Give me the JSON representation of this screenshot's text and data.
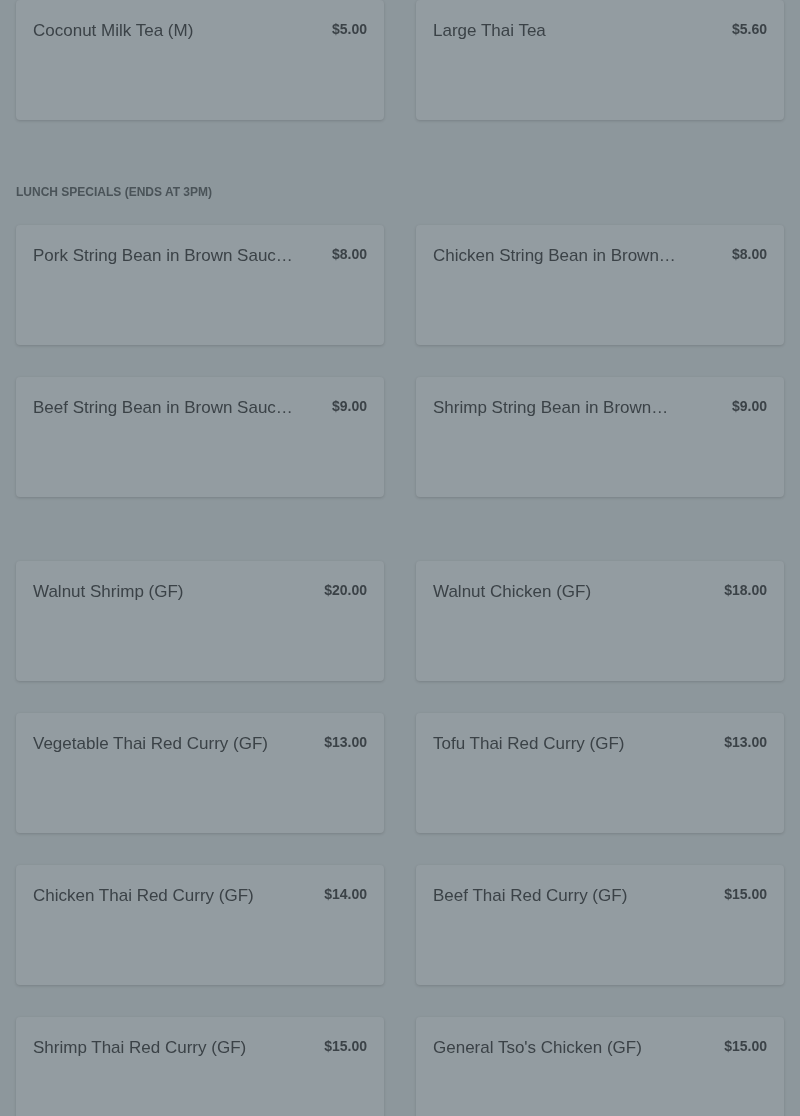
{
  "sections": [
    {
      "items": [
        {
          "name": "Coconut Milk Tea (M)",
          "price": "$5.00"
        },
        {
          "name": "Large Thai Tea",
          "price": "$5.60"
        }
      ]
    },
    {
      "title": "LUNCH SPECIALS (ENDS AT 3PM)",
      "items": [
        {
          "name": "Pork String Bean in Brown Sauc…",
          "price": "$8.00"
        },
        {
          "name": "Chicken String Bean in Brown…",
          "price": "$8.00"
        },
        {
          "name": "Beef String Bean in Brown Sauc…",
          "price": "$9.00"
        },
        {
          "name": "Shrimp String Bean in Brown…",
          "price": "$9.00"
        }
      ]
    },
    {
      "items": [
        {
          "name": "Walnut Shrimp (GF)",
          "price": "$20.00"
        },
        {
          "name": "Walnut Chicken (GF)",
          "price": "$18.00"
        },
        {
          "name": "Vegetable Thai Red Curry (GF)",
          "price": "$13.00"
        },
        {
          "name": "Tofu Thai Red Curry (GF)",
          "price": "$13.00"
        },
        {
          "name": "Chicken Thai Red Curry (GF)",
          "price": "$14.00"
        },
        {
          "name": "Beef Thai Red Curry (GF)",
          "price": "$15.00"
        },
        {
          "name": "Shrimp Thai Red Curry (GF)",
          "price": "$15.00"
        },
        {
          "name": "General Tso's Chicken (GF)",
          "price": "$15.00"
        }
      ]
    }
  ]
}
